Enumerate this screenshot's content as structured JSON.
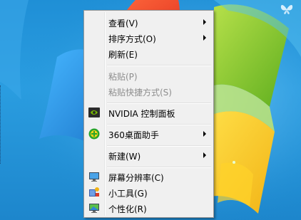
{
  "menu": {
    "items": [
      {
        "label": "查看(V)",
        "submenu": true
      },
      {
        "label": "排序方式(O)",
        "submenu": true
      },
      {
        "label": "刷新(E)"
      },
      {
        "label": "粘贴(P)",
        "disabled": true
      },
      {
        "label": "粘贴快捷方式(S)",
        "disabled": true
      },
      {
        "label": "NVIDIA 控制面板",
        "icon": "nvidia-icon"
      },
      {
        "label": "360桌面助手",
        "icon": "360-icon",
        "submenu": true
      },
      {
        "label": "新建(W)",
        "submenu": true
      },
      {
        "label": "屏幕分辨率(C)",
        "icon": "monitor-icon"
      },
      {
        "label": "小工具(G)",
        "icon": "gadgets-icon"
      },
      {
        "label": "个性化(R)",
        "icon": "personalize-icon"
      }
    ]
  },
  "colors": {
    "menu_bg": "#f0f0f0",
    "disabled_text": "#8d8d8d",
    "desktop_blue": "#1f8fd6"
  }
}
